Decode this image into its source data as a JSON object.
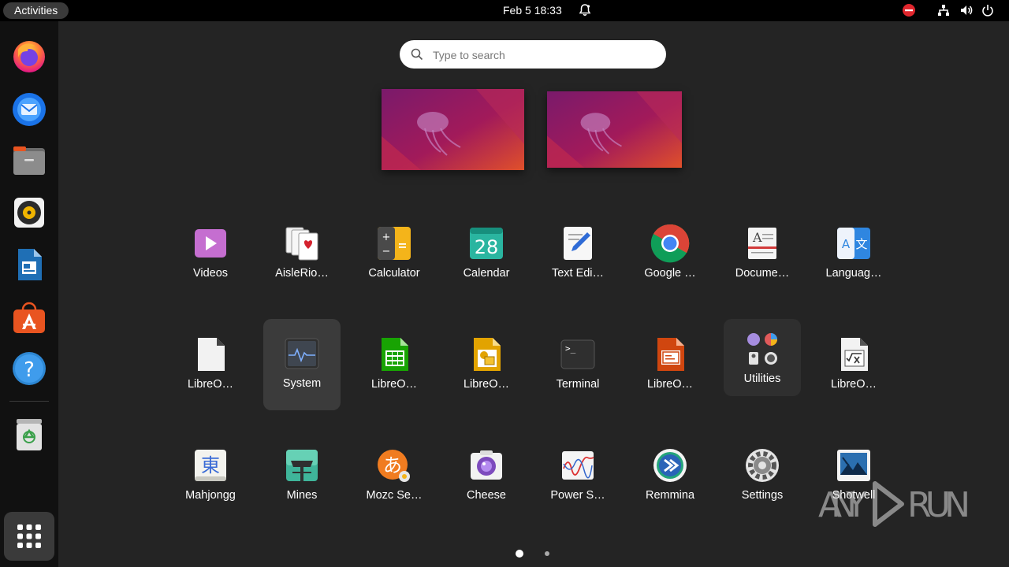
{
  "topbar": {
    "activities_label": "Activities",
    "clock": "Feb 5  18:33",
    "tray": [
      "stop-icon",
      "network-icon",
      "volume-icon",
      "power-icon"
    ]
  },
  "dock": {
    "items": [
      "firefox",
      "thunderbird",
      "files",
      "rhythmbox",
      "libreoffice-writer",
      "app-center",
      "help",
      "trash"
    ],
    "show_apps_label": "Show Applications"
  },
  "search": {
    "placeholder": "Type to search",
    "value": ""
  },
  "apps": [
    [
      {
        "label": "Videos",
        "icon": "videos-icon"
      },
      {
        "label": "AisleRio…",
        "icon": "cards-icon"
      },
      {
        "label": "Calculator",
        "icon": "calculator-icon"
      },
      {
        "label": "Calendar",
        "icon": "calendar-icon",
        "icon_text": "28"
      },
      {
        "label": "Text Edi…",
        "icon": "text-editor-icon"
      },
      {
        "label": "Google …",
        "icon": "chrome-icon"
      },
      {
        "label": "Docume…",
        "icon": "document-viewer-icon"
      },
      {
        "label": "Languag…",
        "icon": "language-icon",
        "icon_text": "A 文"
      }
    ],
    [
      {
        "label": "LibreO…",
        "icon": "libreoffice-icon"
      },
      {
        "label": "System",
        "icon": "system-monitor-icon",
        "highlighted": true
      },
      {
        "label": "LibreO…",
        "icon": "libreoffice-calc-icon"
      },
      {
        "label": "LibreO…",
        "icon": "libreoffice-draw-icon"
      },
      {
        "label": "Terminal",
        "icon": "terminal-icon",
        "icon_text": ">_"
      },
      {
        "label": "LibreO…",
        "icon": "libreoffice-impress-icon"
      },
      {
        "label": "Utilities",
        "icon": "utilities-folder-icon",
        "folder": true
      },
      {
        "label": "LibreO…",
        "icon": "libreoffice-math-icon"
      }
    ],
    [
      {
        "label": "Mahjongg",
        "icon": "mahjongg-icon",
        "icon_text": "東"
      },
      {
        "label": "Mines",
        "icon": "mines-icon"
      },
      {
        "label": "Mozc Se…",
        "icon": "mozc-icon",
        "icon_text": "あ"
      },
      {
        "label": "Cheese",
        "icon": "cheese-icon"
      },
      {
        "label": "Power S…",
        "icon": "power-statistics-icon"
      },
      {
        "label": "Remmina",
        "icon": "remmina-icon"
      },
      {
        "label": "Settings",
        "icon": "settings-gear-icon"
      },
      {
        "label": "Shotwell",
        "icon": "shotwell-icon"
      }
    ]
  ],
  "pages": {
    "total": 2,
    "current": 1
  },
  "watermark": "ANY RUN",
  "colors": {
    "accent": "#e95420",
    "background": "#242424",
    "dock": "#111111"
  }
}
